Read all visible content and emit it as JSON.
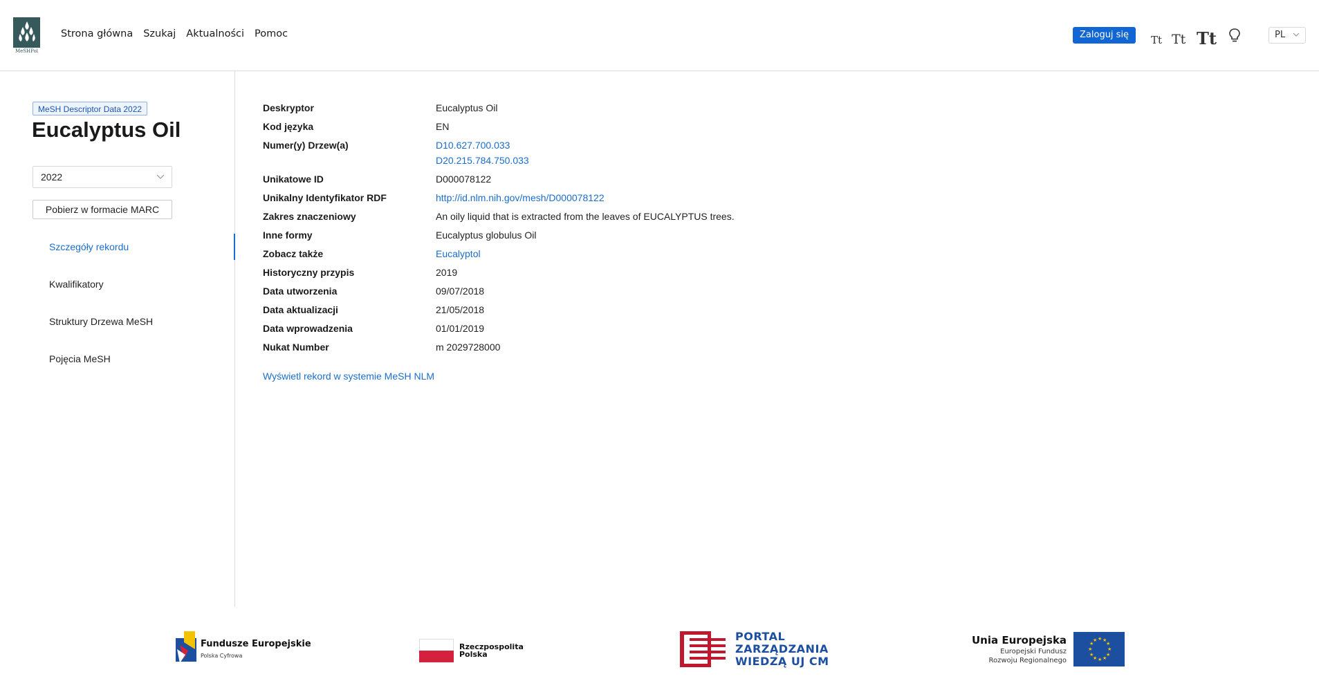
{
  "header": {
    "logo_text": "MeSHPol",
    "nav": [
      "Strona główna",
      "Szukaj",
      "Aktualności",
      "Pomoc"
    ],
    "login_label": "Zaloguj się",
    "font_size_icons": [
      "Tt",
      "Tt",
      "Tt"
    ],
    "contrast_icon": "lightbulb-icon",
    "language": "PL"
  },
  "sidebar": {
    "badge": "MeSH Descriptor Data 2022",
    "title": "Eucalyptus Oil",
    "year_select": "2022",
    "marc_button": "Pobierz w formacie MARC",
    "items": [
      {
        "label": "Szczegóły rekordu",
        "active": true
      },
      {
        "label": "Kwalifikatory",
        "active": false
      },
      {
        "label": "Struktury Drzewa MeSH",
        "active": false
      },
      {
        "label": "Pojęcia MeSH",
        "active": false
      }
    ]
  },
  "details": {
    "descriptor_label": "Deskryptor",
    "descriptor_value": "Eucalyptus Oil",
    "language_label": "Kod języka",
    "language_value": "EN",
    "tree_label": "Numer(y) Drzew(a)",
    "tree_values": [
      "D10.627.700.033",
      "D20.215.784.750.033"
    ],
    "uid_label": "Unikatowe ID",
    "uid_value": "D000078122",
    "rdf_label": "Unikalny Identyfikator RDF",
    "rdf_value": "http://id.nlm.nih.gov/mesh/D000078122",
    "scope_label": "Zakres znaczeniowy",
    "scope_value": "An oily liquid that is extracted from the leaves of EUCALYPTUS trees.",
    "other_forms_label": "Inne formy",
    "other_forms_value": "Eucalyptus globulus Oil",
    "see_also_label": "Zobacz także",
    "see_also_value": "Eucalyptol",
    "history_label": "Historyczny przypis",
    "history_value": "2019",
    "created_label": "Data utworzenia",
    "created_value": "09/07/2018",
    "updated_label": "Data aktualizacji",
    "updated_value": "21/05/2018",
    "introduced_label": "Data wprowadzenia",
    "introduced_value": "01/01/2019",
    "nukat_label": "Nukat Number",
    "nukat_value": "m 2029728000"
  },
  "nlm_link": "Wyświetl rekord w systemie MeSH NLM",
  "footer": {
    "fe_title": "Fundusze Europejskie",
    "fe_sub": "Polska Cyfrowa",
    "rp": "Rzeczpospolita Polska",
    "portal": [
      "PORTAL",
      "ZARZĄDZANIA",
      "WIEDZĄ UJ CM"
    ],
    "ue_title": "Unia Europejska",
    "ue_sub": [
      "Europejski Fundusz",
      "Rozwoju Regionalnego"
    ]
  },
  "colors": {
    "accent": "#1a6dcc",
    "login_bg": "#1266d4",
    "logo_bg": "#36595c"
  }
}
